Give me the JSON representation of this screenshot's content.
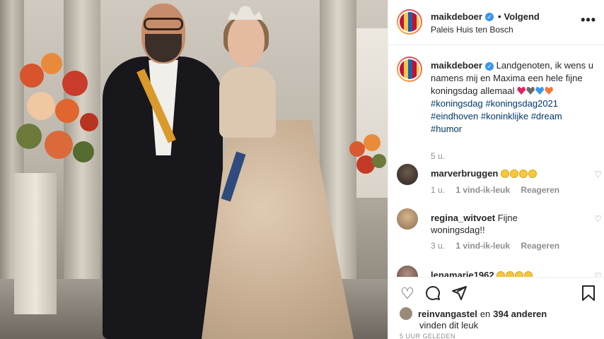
{
  "post": {
    "author": "maikdeboer",
    "follow_label": "Volgend",
    "location": "Paleis Huis ten Bosch",
    "more_label": "•••"
  },
  "caption": {
    "author": "maikdeboer",
    "text": " Landgenoten, ik wens u namens mij en Maxima een hele fijne koningsdag allemaal ",
    "hashtags": [
      "#koningsdag",
      "#koningsdag2021",
      "#eindhoven",
      "#koninklijke",
      "#dream",
      "#humor"
    ],
    "emoji_colors": [
      "#e0245e",
      "#6b6b6b",
      "#3897f0",
      "#f77737"
    ],
    "time": "5 u."
  },
  "comments": [
    {
      "user": "marverbruggen",
      "text": "",
      "laughs": 4,
      "time": "1 u.",
      "likes": "1 vind-ik-leuk",
      "reply": "Reageren"
    },
    {
      "user": "regina_witvoet",
      "text": "Fijne woningsdag!!",
      "laughs": 0,
      "time": "3 u.",
      "likes": "1 vind-ik-leuk",
      "reply": "Reageren"
    },
    {
      "user": "lenamarie1962",
      "text": "",
      "laughs": 4
    }
  ],
  "likes": {
    "user": "reinvangastel",
    "connector": "en",
    "count_text": "394 anderen",
    "line2": "vinden dit leuk"
  },
  "footer": {
    "age": "5 UUR GELEDEN"
  },
  "icons": [
    "heart-icon",
    "comment-icon",
    "share-icon",
    "bookmark-icon",
    "verified-icon",
    "more-icon"
  ],
  "colors": {
    "link": "#00376b",
    "verified": "#3897f0",
    "muted": "#8e8e8e"
  }
}
